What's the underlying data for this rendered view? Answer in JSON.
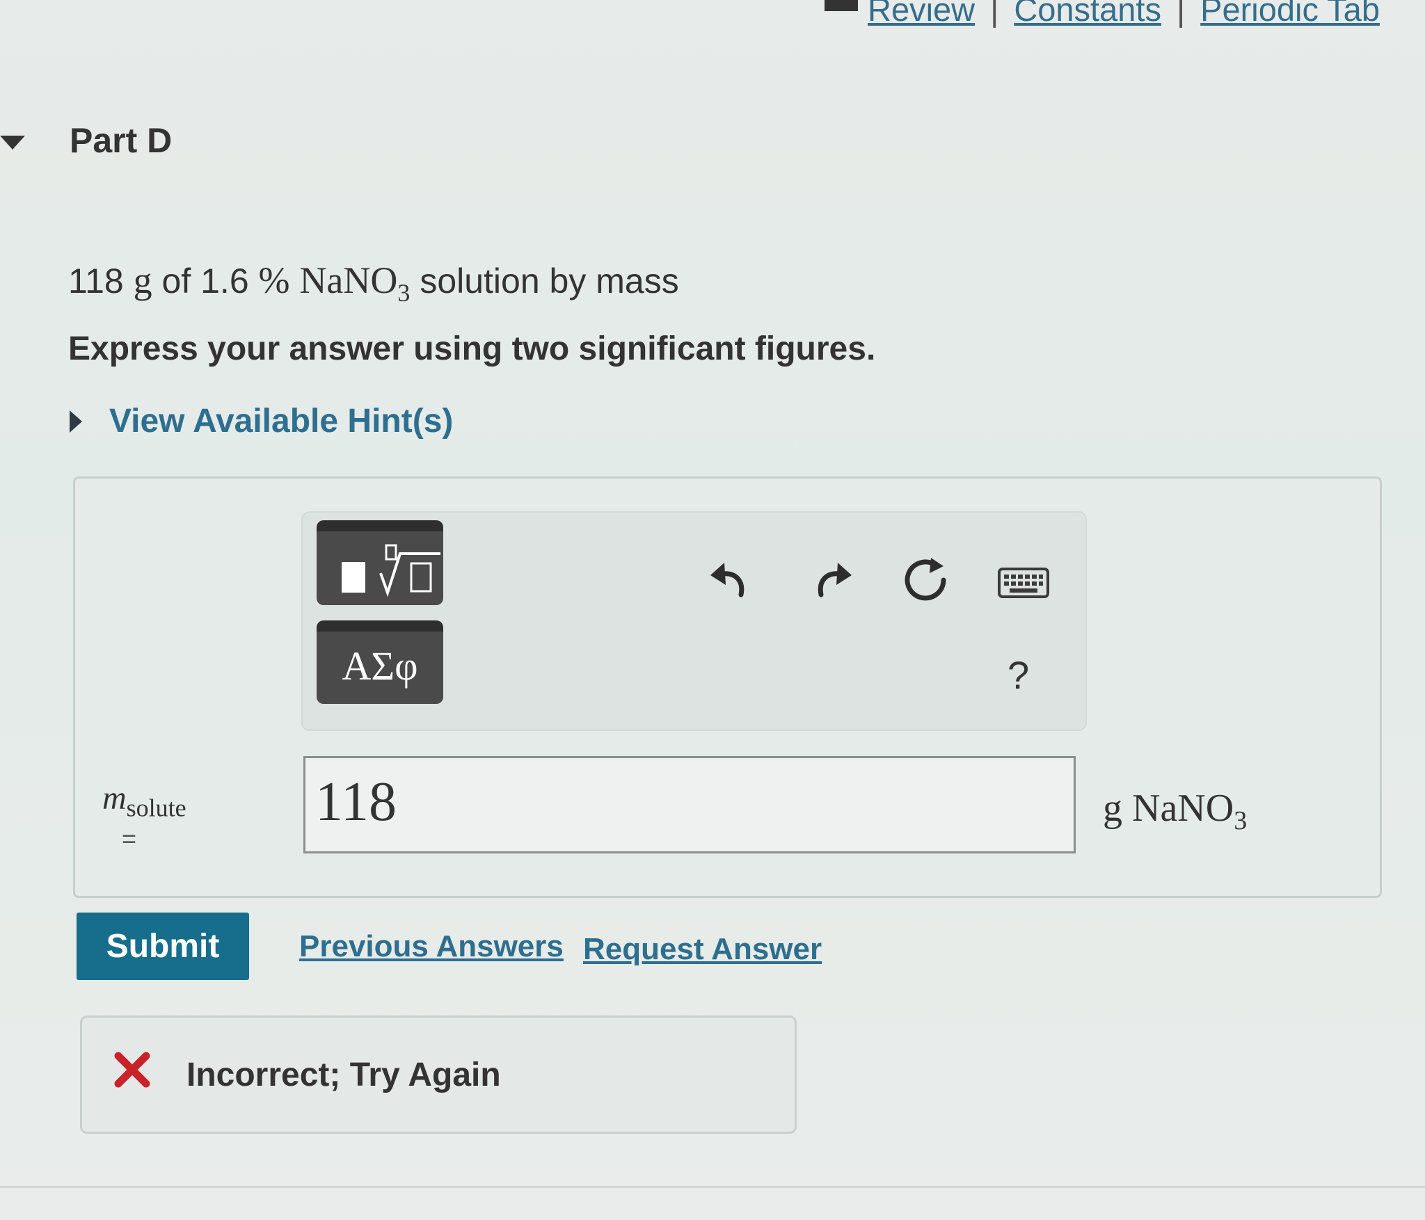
{
  "header": {
    "links": [
      "Review",
      "Constants",
      "Periodic Tab"
    ],
    "separator": "|",
    "book_icon": "book-icon"
  },
  "part": {
    "title": "Part D"
  },
  "question": {
    "mass": "118",
    "mass_unit": "g",
    "of": "of 1.6",
    "percent": "%",
    "formula_main": "NaNO",
    "formula_sub": "3",
    "rest": "solution by mass"
  },
  "instruction": "Express your answer using two significant figures.",
  "hint_link": "View Available Hint(s)",
  "toolbar": {
    "greek_label": "ΑΣφ",
    "help_label": "?",
    "icons": [
      "templates-icon",
      "greek-symbols-icon",
      "undo-icon",
      "redo-icon",
      "reset-icon",
      "keyboard-icon",
      "help-icon"
    ]
  },
  "answer": {
    "var_main": "m",
    "var_sub": "solute",
    "equals": "=",
    "value": "118",
    "unit_main": "g NaNO",
    "unit_sub": "3"
  },
  "actions": {
    "submit": "Submit",
    "previous_answers": "Previous Answers",
    "request_answer": "Request Answer"
  },
  "feedback": {
    "text": "Incorrect; Try Again",
    "icon": "x-icon"
  },
  "colors": {
    "link": "#2e6e8e",
    "submit_bg": "#176d8c",
    "error": "#c8232b"
  }
}
